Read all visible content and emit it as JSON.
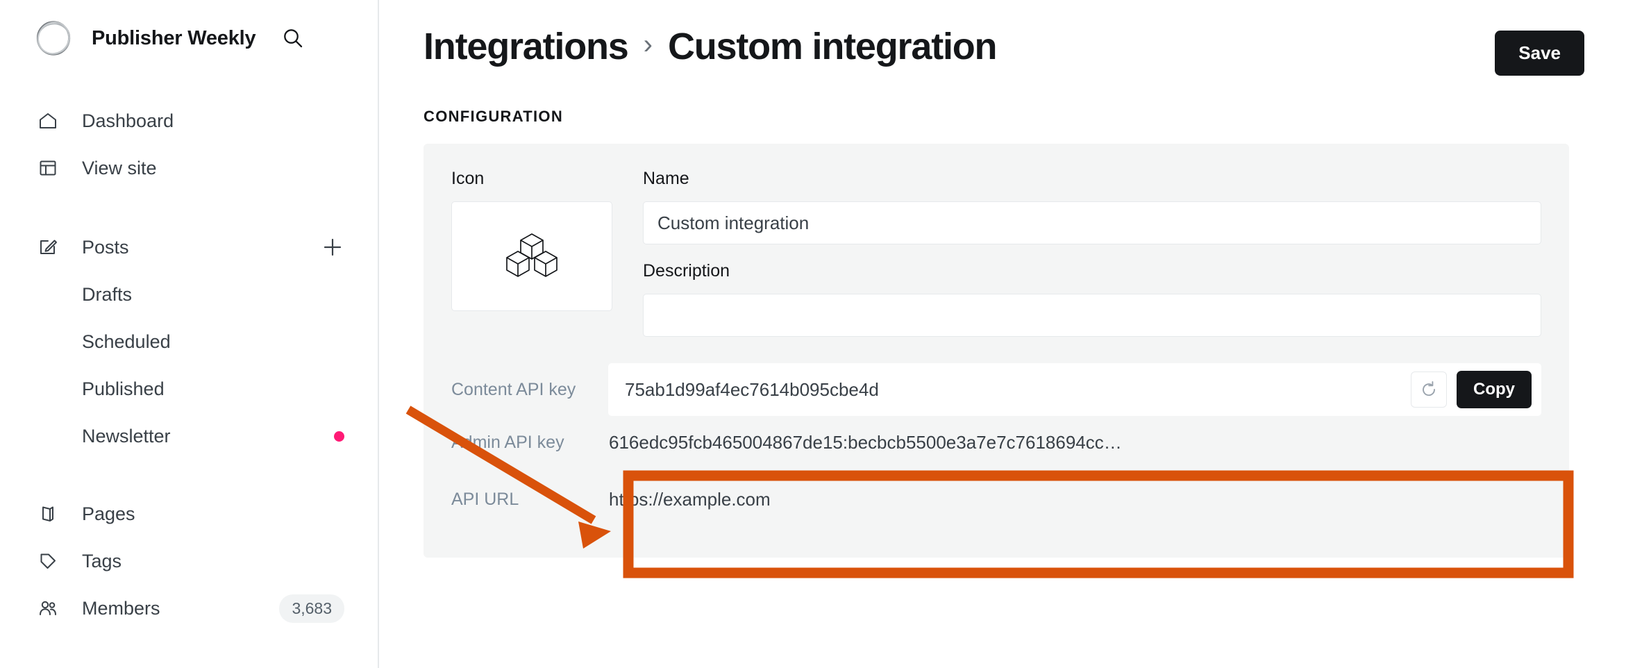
{
  "sidebar": {
    "brand": {
      "name": "Publisher Weekly",
      "logo_icon": "circle-scribble-logo",
      "search_icon": "search-icon"
    },
    "groups": [
      {
        "items": [
          {
            "label": "Dashboard",
            "icon": "home-icon",
            "sub": false
          },
          {
            "label": "View site",
            "icon": "layout-icon",
            "sub": false
          }
        ]
      },
      {
        "items": [
          {
            "label": "Posts",
            "icon": "edit-pencil-icon",
            "sub": false,
            "action_icon": "plus-icon"
          },
          {
            "label": "Drafts",
            "icon": "",
            "sub": true
          },
          {
            "label": "Scheduled",
            "icon": "",
            "sub": true
          },
          {
            "label": "Published",
            "icon": "",
            "sub": true
          },
          {
            "label": "Newsletter",
            "icon": "",
            "sub": true,
            "dot": true
          }
        ]
      },
      {
        "items": [
          {
            "label": "Pages",
            "icon": "pages-icon",
            "sub": false
          },
          {
            "label": "Tags",
            "icon": "tag-icon",
            "sub": false
          },
          {
            "label": "Members",
            "icon": "members-icon",
            "sub": false,
            "badge": "3,683"
          }
        ]
      }
    ]
  },
  "header": {
    "breadcrumb_parent": "Integrations",
    "breadcrumb_separator": "›",
    "breadcrumb_current": "Custom integration",
    "save_label": "Save"
  },
  "configuration": {
    "section_label": "CONFIGURATION",
    "icon_field_label": "Icon",
    "icon_glyph": "three-cubes-icon",
    "name_field_label": "Name",
    "name_value": "Custom integration",
    "name_placeholder": "",
    "description_field_label": "Description",
    "description_value": "",
    "description_placeholder": "",
    "content_api_key_label": "Content API key",
    "content_api_key_value": "75ab1d99af4ec7614b095cbe4d",
    "refresh_icon": "refresh-circular-arrow-icon",
    "copy_label": "Copy",
    "admin_api_key_label": "Admin API key",
    "admin_api_key_value": "616edc95fcb465004867de15:becbcb5500e3a7e7c7618694cc…",
    "api_url_label": "API URL",
    "api_url_value": "https://example.com"
  },
  "annotation": {
    "highlight_color": "#d9520b",
    "arrow_icon": "arrow-pointer-annotation",
    "highlight_box_icon": "highlight-rectangle-annotation"
  },
  "colors": {
    "accent_dark": "#15171a",
    "muted_label": "#7c8b9a",
    "nav_text": "#394047",
    "panel_bg": "#f4f5f5",
    "dot_pink": "#ff1a75",
    "annotation_orange": "#d9520b"
  }
}
